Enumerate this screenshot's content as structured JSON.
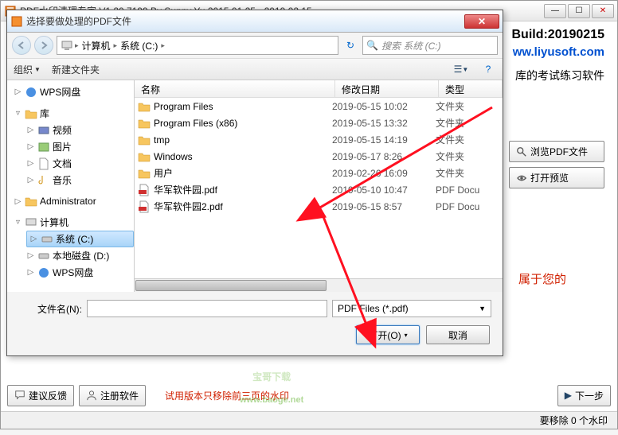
{
  "main": {
    "title": "PDF水印清理专家 V1.20.7199 By Sunny Yu 2015.01.25 - 2019.02.15",
    "build": "Build:20190215",
    "url": "ww.liyusoft.com",
    "promo": "库的考试练习软件",
    "browse_btn": "浏览PDF文件",
    "preview_btn": "打开预览",
    "red_text": "属于您的",
    "feedback_btn": "建议反馈",
    "register_btn": "注册软件",
    "trial_note": "试用版本只移除前三页的水印",
    "next_btn": "下一步",
    "status": "要移除 0 个水印"
  },
  "dialog": {
    "title": "选择要做处理的PDF文件",
    "breadcrumb": {
      "b0": "计算机",
      "b1": "系统 (C:)"
    },
    "search_placeholder": "搜索 系统 (C:)",
    "toolbar": {
      "organize": "组织",
      "newfolder": "新建文件夹"
    },
    "tree": {
      "t0": "WPS网盘",
      "t1": "库",
      "t2": "视频",
      "t3": "图片",
      "t4": "文档",
      "t5": "音乐",
      "t6": "Administrator",
      "t7": "计算机",
      "t8": "系统 (C:)",
      "t9": "本地磁盘 (D:)",
      "t10": "WPS网盘"
    },
    "columns": {
      "name": "名称",
      "date": "修改日期",
      "type": "类型"
    },
    "files": [
      {
        "name": "Program Files",
        "date": "2019-05-15 10:02",
        "type": "文件夹",
        "kind": "folder"
      },
      {
        "name": "Program Files (x86)",
        "date": "2019-05-15 13:32",
        "type": "文件夹",
        "kind": "folder"
      },
      {
        "name": "tmp",
        "date": "2019-05-15 14:19",
        "type": "文件夹",
        "kind": "folder"
      },
      {
        "name": "Windows",
        "date": "2019-05-17 8:26",
        "type": "文件夹",
        "kind": "folder"
      },
      {
        "name": "用户",
        "date": "2019-02-26 16:09",
        "type": "文件夹",
        "kind": "folder"
      },
      {
        "name": "华军软件园.pdf",
        "date": "2019-05-10 10:47",
        "type": "PDF Docu",
        "kind": "pdf"
      },
      {
        "name": "华军软件园2.pdf",
        "date": "2019-05-15 8:57",
        "type": "PDF Docu",
        "kind": "pdf"
      }
    ],
    "filename_label": "文件名(N):",
    "filter": "PDF Files (*.pdf)",
    "open_btn": "打开(O)",
    "cancel_btn": "取消"
  },
  "watermark": {
    "line1": "宝哥下载",
    "line2": "www.baoge.net"
  }
}
